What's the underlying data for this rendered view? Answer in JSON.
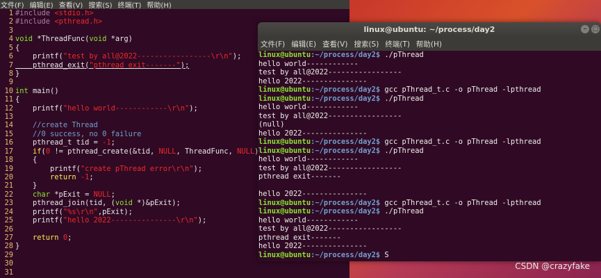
{
  "editor": {
    "menu": [
      "文件(F)",
      "编辑(E)",
      "查看(V)",
      "搜索(S)",
      "终端(T)",
      "帮助(H)"
    ],
    "lines": [
      {
        "n": "1",
        "parts": [
          [
            "k-pre",
            "#include "
          ],
          [
            "k-str",
            "<stdio.h>"
          ]
        ]
      },
      {
        "n": "2",
        "parts": [
          [
            "k-pre",
            "#include "
          ],
          [
            "k-str",
            "<pthread.h>"
          ]
        ]
      },
      {
        "n": "3",
        "parts": []
      },
      {
        "n": "4",
        "parts": [
          [
            "k-type",
            "void"
          ],
          [
            "",
            " *ThreadFunc("
          ],
          [
            "k-type",
            "void"
          ],
          [
            "",
            " *arg)"
          ]
        ]
      },
      {
        "n": "5",
        "parts": [
          [
            "",
            "{"
          ]
        ]
      },
      {
        "n": "6",
        "parts": [
          [
            "",
            "    printf("
          ],
          [
            "k-str",
            "\"test by all@2022-----------------\\r\\n\""
          ],
          [
            "",
            ");"
          ]
        ]
      },
      {
        "n": "7",
        "parts": [
          [
            "",
            "    pthread_exit("
          ],
          [
            "k-str",
            "\"pthread exit-------\""
          ],
          [
            "",
            ");"
          ]
        ],
        "cursor": true
      },
      {
        "n": "8",
        "parts": [
          [
            "",
            "}"
          ]
        ]
      },
      {
        "n": "9",
        "parts": []
      },
      {
        "n": "10",
        "parts": [
          [
            "k-type",
            "int"
          ],
          [
            "",
            " main()"
          ]
        ]
      },
      {
        "n": "11",
        "parts": [
          [
            "",
            "{"
          ]
        ]
      },
      {
        "n": "12",
        "parts": [
          [
            "",
            "    printf("
          ],
          [
            "k-str",
            "\"hello world------------\\r\\n\""
          ],
          [
            "",
            ");"
          ]
        ]
      },
      {
        "n": "13",
        "parts": []
      },
      {
        "n": "14",
        "parts": [
          [
            "k-com",
            "    //create Thread"
          ]
        ]
      },
      {
        "n": "15",
        "parts": [
          [
            "k-com",
            "    //0 success, no 0 failure"
          ]
        ]
      },
      {
        "n": "16",
        "parts": [
          [
            "",
            "    pthread_t tid = "
          ],
          [
            "k-num",
            "-1"
          ],
          [
            "",
            ";"
          ]
        ]
      },
      {
        "n": "17",
        "parts": [
          [
            "k-key",
            "    if"
          ],
          [
            "",
            "("
          ],
          [
            "k-num",
            "0"
          ],
          [
            "",
            " != pthread_create(&tid, "
          ],
          [
            "k-const",
            "NULL"
          ],
          [
            "",
            ", ThreadFunc, "
          ],
          [
            "k-const",
            "NULL"
          ],
          [
            "",
            ")"
          ]
        ]
      },
      {
        "n": "18",
        "parts": [
          [
            "",
            "    {"
          ]
        ]
      },
      {
        "n": "19",
        "parts": [
          [
            "",
            "        printf("
          ],
          [
            "k-str",
            "\"create pThread error\\r\\n\""
          ],
          [
            "",
            ");"
          ]
        ]
      },
      {
        "n": "20",
        "parts": [
          [
            "k-key",
            "        return"
          ],
          [
            "",
            " "
          ],
          [
            "k-num",
            "-1"
          ],
          [
            "",
            ";"
          ]
        ]
      },
      {
        "n": "21",
        "parts": [
          [
            "",
            "    }"
          ]
        ]
      },
      {
        "n": "22",
        "parts": [
          [
            "k-type",
            "    char"
          ],
          [
            "",
            " *pExit = "
          ],
          [
            "k-const",
            "NULL"
          ],
          [
            "",
            ";"
          ]
        ]
      },
      {
        "n": "23",
        "parts": [
          [
            "",
            "    pthread_join(tid, ("
          ],
          [
            "k-type",
            "void"
          ],
          [
            "",
            " *)&pExit);"
          ]
        ]
      },
      {
        "n": "24",
        "parts": [
          [
            "",
            "    printf("
          ],
          [
            "k-str",
            "\"%s\\r\\n\""
          ],
          [
            "",
            ",pExit);"
          ]
        ]
      },
      {
        "n": "25",
        "parts": [
          [
            "",
            "    printf("
          ],
          [
            "k-str",
            "\"hello 2022---------------\\r\\n\""
          ],
          [
            "",
            ");"
          ]
        ]
      },
      {
        "n": "26",
        "parts": []
      },
      {
        "n": "27",
        "parts": [
          [
            "k-key",
            "    return"
          ],
          [
            "",
            " "
          ],
          [
            "k-num",
            "0"
          ],
          [
            "",
            ";"
          ]
        ]
      },
      {
        "n": "28",
        "parts": [
          [
            "",
            "}"
          ]
        ]
      },
      {
        "n": "29",
        "parts": []
      },
      {
        "n": "30",
        "parts": []
      },
      {
        "n": "31",
        "parts": []
      }
    ]
  },
  "terminal": {
    "title": "linux@ubuntu: ~/process/day2",
    "menu": [
      "文件(F)",
      "编辑(E)",
      "查看(V)",
      "搜索(S)",
      "终端(T)",
      "帮助(H)"
    ],
    "prompt_user": "linux@ubuntu",
    "prompt_path": ":~/process/day2$",
    "lines": [
      {
        "type": "cmd",
        "text": " ./pThread"
      },
      {
        "type": "out",
        "text": "hello world------------"
      },
      {
        "type": "out",
        "text": "test by all@2022-----------------"
      },
      {
        "type": "out",
        "text": "hello 2022---------------"
      },
      {
        "type": "cmd",
        "text": " gcc pThread_t.c -o pThread -lpthread"
      },
      {
        "type": "cmd",
        "text": " ./pThread"
      },
      {
        "type": "out",
        "text": "hello world------------"
      },
      {
        "type": "out",
        "text": "test by all@2022-----------------"
      },
      {
        "type": "out",
        "text": "(null)"
      },
      {
        "type": "out",
        "text": "hello 2022---------------"
      },
      {
        "type": "cmd",
        "text": " gcc pThread_t.c -o pThread -lpthread"
      },
      {
        "type": "cmd",
        "text": " ./pThread"
      },
      {
        "type": "out",
        "text": "hello world------------"
      },
      {
        "type": "out",
        "text": "test by all@2022-----------------"
      },
      {
        "type": "out",
        "text": "pthread exit-------"
      },
      {
        "type": "out",
        "text": ""
      },
      {
        "type": "out",
        "text": "hello 2022---------------"
      },
      {
        "type": "cmd",
        "text": " gcc pThread_t.c -o pThread -lpthread"
      },
      {
        "type": "cmd",
        "text": " ./pThread"
      },
      {
        "type": "out",
        "text": "hello world------------"
      },
      {
        "type": "out",
        "text": "test by all@2022-----------------"
      },
      {
        "type": "out",
        "text": "pthread exit-------"
      },
      {
        "type": "out",
        "text": "hello 2022---------------"
      },
      {
        "type": "cmd",
        "text": " S"
      }
    ]
  },
  "watermark": "CSDN @crazyfake"
}
